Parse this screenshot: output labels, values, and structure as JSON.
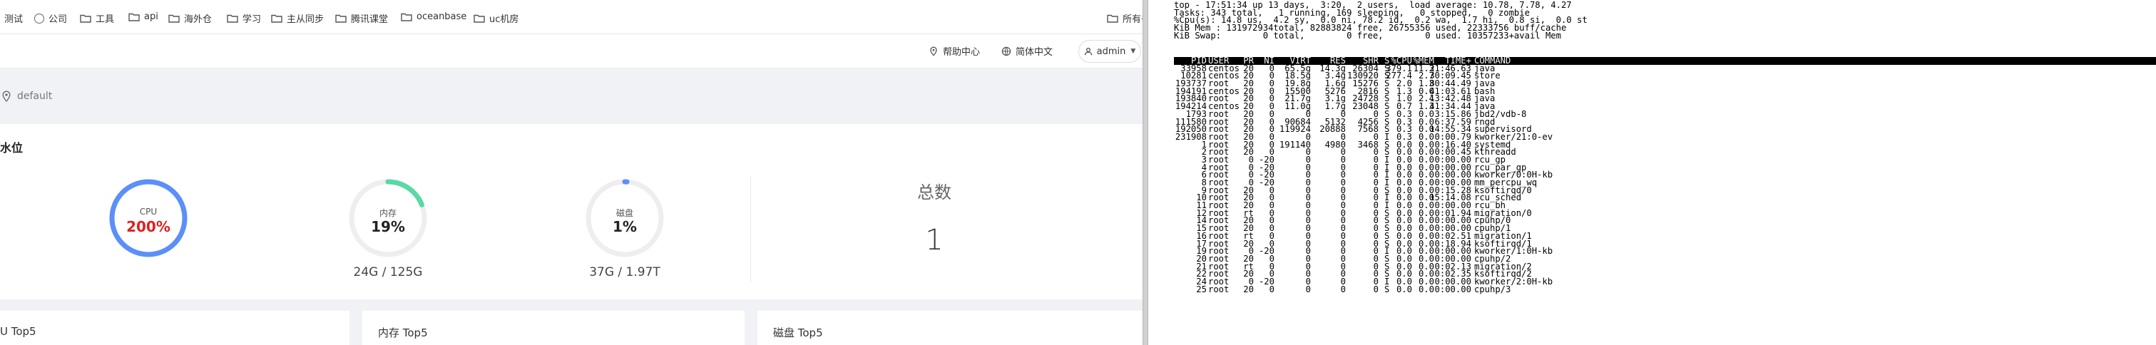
{
  "bookmarks": [
    {
      "label": "测试",
      "icon": "none"
    },
    {
      "label": "公司",
      "icon": "globe-icon"
    },
    {
      "label": "工具",
      "icon": "folder-icon"
    },
    {
      "label": "api",
      "icon": "folder-icon"
    },
    {
      "label": "海外仓",
      "icon": "folder-icon"
    },
    {
      "label": "学习",
      "icon": "folder-icon"
    },
    {
      "label": "主从同步",
      "icon": "folder-icon"
    },
    {
      "label": "腾讯课堂",
      "icon": "folder-icon"
    },
    {
      "label": "oceanbase",
      "icon": "folder-icon"
    },
    {
      "label": "uc机房",
      "icon": "folder-icon"
    }
  ],
  "all_bookmarks": "所有书签",
  "header": {
    "help": "帮助中心",
    "language": "简体中文",
    "user": "admin"
  },
  "location": "default",
  "water_section": {
    "title": "水位",
    "gauges": [
      {
        "label": "CPU",
        "value": "200%",
        "fraction": 1.0,
        "color": "#5b8ff9",
        "value_color": "#e02020",
        "sub": ""
      },
      {
        "label": "内存",
        "value": "19%",
        "fraction": 0.19,
        "color": "#5ad8a6",
        "value_color": "#222222",
        "sub": "24G / 125G"
      },
      {
        "label": "磁盘",
        "value": "1%",
        "fraction": 0.01,
        "color": "#5b8ff9",
        "value_color": "#222222",
        "sub": "37G / 1.97T"
      }
    ],
    "total_label": "总数",
    "total_value": "1"
  },
  "top5": [
    "U Top5",
    "内存 Top5",
    "磁盘 Top5"
  ],
  "terminal": {
    "summary": [
      "top - 17:51:34 up 13 days,  3:20,  2 users,  load average: 10.78, 7.78, 4.27",
      "Tasks: 343 total,   1 running, 169 sleeping,   0 stopped,   0 zombie",
      "%Cpu(s): 14.8 us,  4.2 sy,  0.0 ni, 78.2 id,  0.2 wa,  1.7 hi,  0.8 si,  0.0 st",
      "KiB Mem : 131972934total, 82883824 free, 26755356 used, 22333756 buff/cache",
      "KiB Swap:        0 total,        0 free,        0 used. 10357233+avail Mem"
    ],
    "columns": [
      "PID",
      "USER",
      "PR",
      "NI",
      "VIRT",
      "RES",
      "SHR",
      "S",
      "%CPU",
      "%MEM",
      "TIME+",
      "COMMAND"
    ],
    "rows": [
      [
        "33958",
        "centos",
        "20",
        "0",
        "65.5g",
        "14.3g",
        "26304",
        "S",
        "379.1",
        "11.3",
        "21:46.63",
        "java"
      ],
      [
        "10281",
        "centos",
        "20",
        "0",
        "18.5g",
        "3.4g",
        "130920",
        "S",
        "277.4",
        "2.7",
        "30:09.45",
        "store"
      ],
      [
        "193737",
        "root",
        "20",
        "0",
        "19.8g",
        "1.6g",
        "15276",
        "S",
        "2.0",
        "1.3",
        "80:44.49",
        "java"
      ],
      [
        "194191",
        "centos",
        "20",
        "0",
        "15500",
        "5276",
        "2816",
        "S",
        "1.3",
        "0.0",
        "41:03.61",
        "bash"
      ],
      [
        "193840",
        "root",
        "20",
        "0",
        "21.7g",
        "3.1g",
        "24728",
        "S",
        "1.0",
        "2.4",
        "13:42.48",
        "java"
      ],
      [
        "194214",
        "centos",
        "20",
        "0",
        "11.0g",
        "1.7g",
        "23048",
        "S",
        "0.7",
        "1.3",
        "41:34.44",
        "java"
      ],
      [
        "1793",
        "root",
        "20",
        "0",
        "0",
        "0",
        "0",
        "S",
        "0.3",
        "0.0",
        "3:15.86",
        "jbd2/vdb-8"
      ],
      [
        "111580",
        "root",
        "20",
        "0",
        "90684",
        "5132",
        "4256",
        "S",
        "0.3",
        "0.0",
        "6:37.59",
        "rngd"
      ],
      [
        "192050",
        "root",
        "20",
        "0",
        "119924",
        "20888",
        "7568",
        "S",
        "0.3",
        "0.0",
        "14:55.34",
        "supervisord"
      ],
      [
        "231908",
        "root",
        "20",
        "0",
        "0",
        "0",
        "0",
        "I",
        "0.3",
        "0.0",
        "0:00.79",
        "kworker/21:0-ev"
      ],
      [
        "1",
        "root",
        "20",
        "0",
        "191140",
        "4980",
        "3468",
        "S",
        "0.0",
        "0.0",
        "0:16.40",
        "systemd"
      ],
      [
        "2",
        "root",
        "20",
        "0",
        "0",
        "0",
        "0",
        "S",
        "0.0",
        "0.0",
        "0:00.45",
        "kthreadd"
      ],
      [
        "3",
        "root",
        "0",
        "-20",
        "0",
        "0",
        "0",
        "I",
        "0.0",
        "0.0",
        "0:00.00",
        "rcu_gp"
      ],
      [
        "4",
        "root",
        "0",
        "-20",
        "0",
        "0",
        "0",
        "I",
        "0.0",
        "0.0",
        "0:00.00",
        "rcu_par_gp"
      ],
      [
        "6",
        "root",
        "0",
        "-20",
        "0",
        "0",
        "0",
        "I",
        "0.0",
        "0.0",
        "0:00.00",
        "kworker/0:0H-kb"
      ],
      [
        "8",
        "root",
        "0",
        "-20",
        "0",
        "0",
        "0",
        "I",
        "0.0",
        "0.0",
        "0:00.00",
        "mm_percpu_wq"
      ],
      [
        "9",
        "root",
        "20",
        "0",
        "0",
        "0",
        "0",
        "S",
        "0.0",
        "0.0",
        "0:15.28",
        "ksoftirqd/0"
      ],
      [
        "10",
        "root",
        "20",
        "0",
        "0",
        "0",
        "0",
        "I",
        "0.0",
        "0.0",
        "15:14.08",
        "rcu_sched"
      ],
      [
        "11",
        "root",
        "20",
        "0",
        "0",
        "0",
        "0",
        "I",
        "0.0",
        "0.0",
        "0:00.00",
        "rcu_bh"
      ],
      [
        "12",
        "root",
        "rt",
        "0",
        "0",
        "0",
        "0",
        "S",
        "0.0",
        "0.0",
        "0:01.94",
        "migration/0"
      ],
      [
        "14",
        "root",
        "20",
        "0",
        "0",
        "0",
        "0",
        "S",
        "0.0",
        "0.0",
        "0:00.00",
        "cpuhp/0"
      ],
      [
        "15",
        "root",
        "20",
        "0",
        "0",
        "0",
        "0",
        "S",
        "0.0",
        "0.0",
        "0:00.00",
        "cpuhp/1"
      ],
      [
        "16",
        "root",
        "rt",
        "0",
        "0",
        "0",
        "0",
        "S",
        "0.0",
        "0.0",
        "0:02.51",
        "migration/1"
      ],
      [
        "17",
        "root",
        "20",
        "0",
        "0",
        "0",
        "0",
        "S",
        "0.0",
        "0.0",
        "0:18.94",
        "ksoftirqd/1"
      ],
      [
        "19",
        "root",
        "0",
        "-20",
        "0",
        "0",
        "0",
        "I",
        "0.0",
        "0.0",
        "0:00.00",
        "kworker/1:0H-kb"
      ],
      [
        "20",
        "root",
        "20",
        "0",
        "0",
        "0",
        "0",
        "S",
        "0.0",
        "0.0",
        "0:00.00",
        "cpuhp/2"
      ],
      [
        "21",
        "root",
        "rt",
        "0",
        "0",
        "0",
        "0",
        "S",
        "0.0",
        "0.0",
        "0:02.13",
        "migration/2"
      ],
      [
        "22",
        "root",
        "20",
        "0",
        "0",
        "0",
        "0",
        "S",
        "0.0",
        "0.0",
        "0:02.35",
        "ksoftirqd/2"
      ],
      [
        "24",
        "root",
        "0",
        "-20",
        "0",
        "0",
        "0",
        "I",
        "0.0",
        "0.0",
        "0:00.00",
        "kworker/2:0H-kb"
      ],
      [
        "25",
        "root",
        "20",
        "0",
        "0",
        "0",
        "0",
        "S",
        "0.0",
        "0.0",
        "0:00.00",
        "cpuhp/3"
      ]
    ]
  }
}
